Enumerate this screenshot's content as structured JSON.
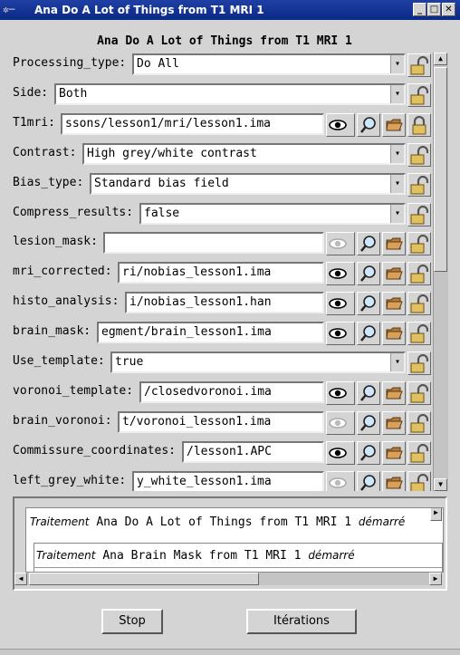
{
  "window": {
    "title": "Ana Do A Lot of Things from T1 MRI 1",
    "min": "_",
    "max": "□",
    "close": "✕"
  },
  "heading": "Ana Do A Lot of Things from T1 MRI 1",
  "fields": [
    {
      "label": "Processing_type:",
      "type": "combo",
      "value": "Do All",
      "lock": "open"
    },
    {
      "label": "Side:",
      "type": "combo",
      "value": "Both",
      "lock": "open"
    },
    {
      "label": "T1mri:",
      "type": "file",
      "value": "ssons/lesson1/mri/lesson1.ima",
      "eye": true,
      "lock": "closed"
    },
    {
      "label": "Contrast:",
      "type": "combo",
      "value": "High grey/white contrast",
      "lock": "open"
    },
    {
      "label": "Bias_type:",
      "type": "combo",
      "value": "Standard bias field",
      "lock": "open"
    },
    {
      "label": "Compress_results:",
      "type": "combo",
      "value": "false",
      "lock": "open"
    },
    {
      "label": "lesion_mask:",
      "type": "file",
      "value": "",
      "eye": false,
      "lock": "open"
    },
    {
      "label": "mri_corrected:",
      "type": "file",
      "value": "ri/nobias_lesson1.ima",
      "eye": true,
      "lock": "open"
    },
    {
      "label": "histo_analysis:",
      "type": "file",
      "value": "i/nobias_lesson1.han",
      "eye": true,
      "lock": "open"
    },
    {
      "label": "brain_mask:",
      "type": "file",
      "value": "egment/brain_lesson1.ima",
      "eye": true,
      "lock": "open"
    },
    {
      "label": "Use_template:",
      "type": "combo",
      "value": "true",
      "lock": "open"
    },
    {
      "label": "voronoi_template:",
      "type": "file",
      "value": "/closedvoronoi.ima",
      "eye": true,
      "lock": "open"
    },
    {
      "label": "brain_voronoi:",
      "type": "file",
      "value": "t/voronoi_lesson1.ima",
      "eye": false,
      "lock": "open"
    },
    {
      "label": "Commissure_coordinates:",
      "type": "file",
      "value": "/lesson1.APC",
      "eye": true,
      "lock": "open"
    },
    {
      "label": "left_grey_white:",
      "type": "file",
      "value": "y_white_lesson1.ima",
      "eye": false,
      "lock": "open"
    }
  ],
  "log": {
    "line1_prefix": "Traitement",
    "line1_text": "Ana Do A Lot of Things from T1 MRI 1",
    "line1_suffix": "démarré",
    "line2_prefix": "Traitement",
    "line2_text": "Ana Brain Mask from T1 MRI 1",
    "line2_suffix": "démarré"
  },
  "buttons": {
    "stop": "Stop",
    "iterations": "Itérations"
  },
  "colors": {
    "titlebar": "#0a2a86",
    "background": "#d4d4d4"
  },
  "icons": {
    "eye": "eye-icon",
    "magnifier": "magnifier-icon",
    "folder": "folder-icon",
    "lock": "padlock-icon"
  }
}
